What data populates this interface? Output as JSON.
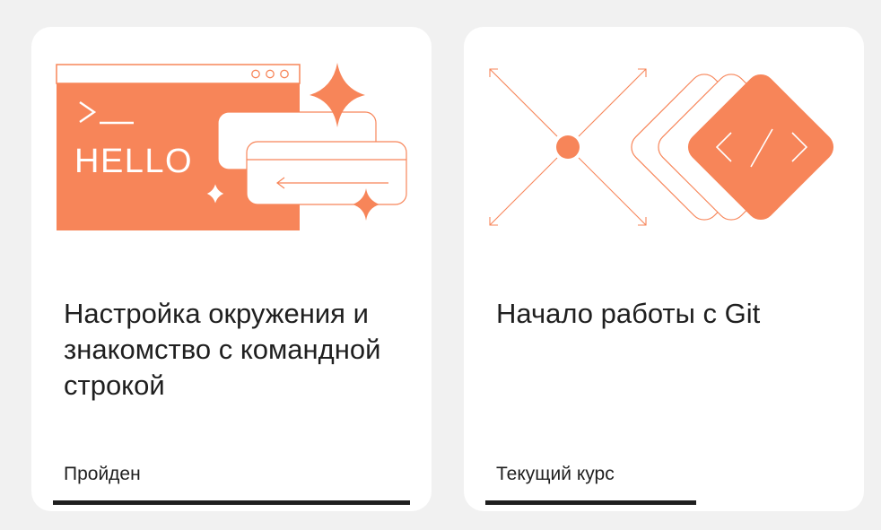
{
  "cards": [
    {
      "illustration": {
        "prompt_glyph": ">_",
        "hello_text": "HELLO",
        "accent_color": "#f78559"
      },
      "title": "Настройка окружения и знакомство с командной строкой",
      "status": "Пройден",
      "progress": 1.0
    },
    {
      "illustration": {
        "code_glyph": "</>",
        "accent_color": "#f78559"
      },
      "title": "Начало работы с Git",
      "status": "Текущий курс",
      "progress": 0.59
    }
  ]
}
